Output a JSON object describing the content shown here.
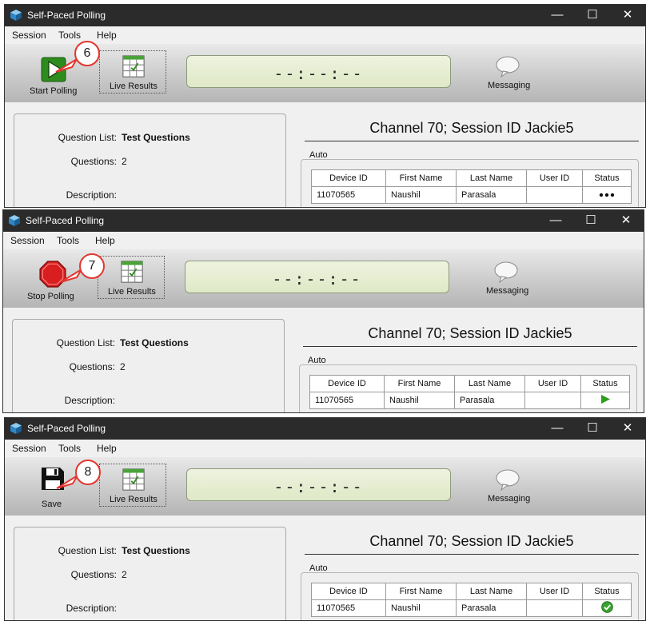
{
  "window_title": "Self-Paced Polling",
  "window_controls": {
    "minimize": "—",
    "maximize": "☐",
    "close": "✕"
  },
  "menu": [
    "Session",
    "Tools",
    "Help"
  ],
  "toolbar": {
    "live_results_label": "Live Results",
    "timer": "--:--:--",
    "messaging_label": "Messaging"
  },
  "info": {
    "question_list_label": "Question List:",
    "question_list_value": "Test Questions",
    "questions_label": "Questions:",
    "questions_value": "2",
    "description_label": "Description:"
  },
  "channel_heading": "Channel 70; Session ID Jackie5",
  "auto_label": "Auto",
  "table": {
    "columns": [
      "Device ID",
      "First Name",
      "Last Name",
      "User ID",
      "Status"
    ],
    "row": {
      "device_id": "11070565",
      "first_name": "Naushil",
      "last_name": "Parasala",
      "user_id": ""
    }
  },
  "steps": [
    {
      "step": "6",
      "action_label": "Start Polling",
      "action_icon": "play-icon",
      "status_icon": "dots-icon"
    },
    {
      "step": "7",
      "action_label": "Stop Polling",
      "action_icon": "stop-icon",
      "status_icon": "play-status-icon"
    },
    {
      "step": "8",
      "action_label": "Save",
      "action_icon": "floppy-disk-icon",
      "status_icon": "check-circle-icon"
    }
  ],
  "colors": {
    "titlebar": "#2b2b2b",
    "callout_border": "#e3362f",
    "play_green": "#2e8b1e",
    "stop_red": "#d81e1e",
    "check_green": "#3aa233"
  }
}
